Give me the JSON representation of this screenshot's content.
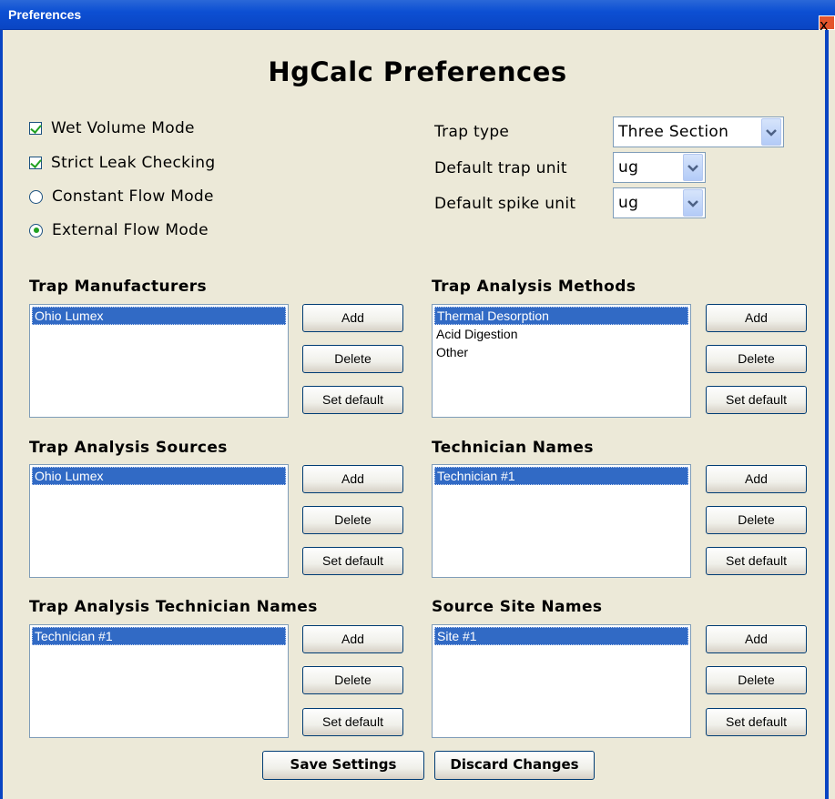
{
  "window": {
    "title": "Preferences",
    "close_glyph": "x"
  },
  "heading": "HgCalc Preferences",
  "options": {
    "wet_volume": {
      "label": "Wet Volume Mode",
      "checked": true
    },
    "strict_leak": {
      "label": "Strict Leak Checking",
      "checked": true
    },
    "constant_flow": {
      "label": "Constant Flow Mode",
      "selected": false
    },
    "external_flow": {
      "label": "External Flow Mode",
      "selected": true
    }
  },
  "settings": {
    "trap_type": {
      "label": "Trap type",
      "value": "Three Section"
    },
    "trap_unit": {
      "label": "Default trap unit",
      "value": "ug"
    },
    "spike_unit": {
      "label": "Default spike unit",
      "value": "ug"
    }
  },
  "lists": {
    "manufacturers": {
      "title": "Trap Manufacturers",
      "items": [
        "Ohio Lumex"
      ]
    },
    "methods": {
      "title": "Trap Analysis Methods",
      "items": [
        "Thermal Desorption",
        "Acid Digestion",
        "Other"
      ]
    },
    "sources": {
      "title": "Trap Analysis Sources",
      "items": [
        "Ohio Lumex"
      ]
    },
    "technicians": {
      "title": "Technician Names",
      "items": [
        "Technician #1"
      ]
    },
    "analysis_technicians": {
      "title": "Trap Analysis Technician Names",
      "items": [
        "Technician #1"
      ]
    },
    "sites": {
      "title": "Source Site Names",
      "items": [
        "Site #1"
      ]
    }
  },
  "buttons": {
    "add": "Add",
    "delete": "Delete",
    "set_default": "Set default",
    "save": "Save Settings",
    "discard": "Discard Changes"
  },
  "colors": {
    "title_bar": "#0c4fd3",
    "selection": "#316ac5",
    "window_bg": "#ece9d8"
  }
}
